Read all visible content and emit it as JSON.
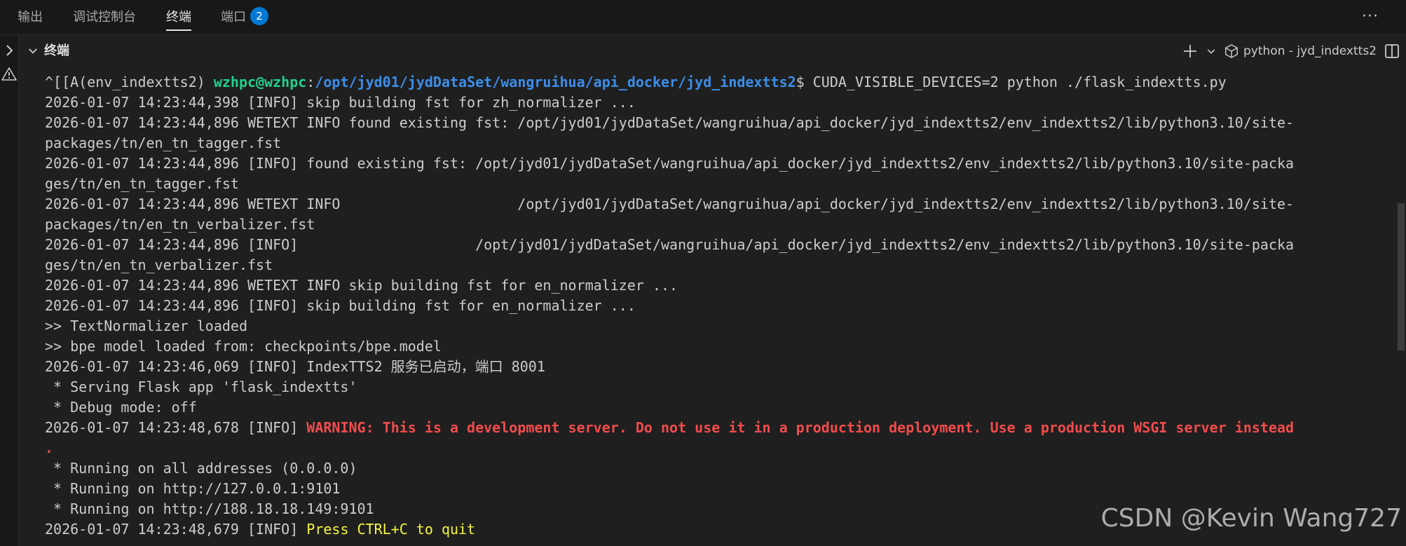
{
  "panel_tabs": [
    {
      "label": "输出"
    },
    {
      "label": "调试控制台"
    },
    {
      "label": "终端"
    },
    {
      "label": "端口",
      "badge": "2"
    }
  ],
  "active_tab": "终端",
  "terminal": {
    "title": "终端",
    "profile_label": "python - jyd_indextts2"
  },
  "prompt": {
    "prefix": "^[[A(env_indextts2) ",
    "user_host": "wzhpc@wzhpc",
    "colon": ":",
    "path": "/opt/jyd01/jydDataSet/wangruihua/api_docker/jyd_indextts2",
    "command": "$ CUDA_VISIBLE_DEVICES=2 python ./flask_indextts.py"
  },
  "lines": [
    "2026-01-07 14:23:44,398 [INFO] skip building fst for zh_normalizer ...",
    "2026-01-07 14:23:44,896 WETEXT INFO found existing fst: /opt/jyd01/jydDataSet/wangruihua/api_docker/jyd_indextts2/env_indextts2/lib/python3.10/site-",
    "packages/tn/en_tn_tagger.fst",
    "2026-01-07 14:23:44,896 [INFO] found existing fst: /opt/jyd01/jydDataSet/wangruihua/api_docker/jyd_indextts2/env_indextts2/lib/python3.10/site-packa",
    "ges/tn/en_tn_tagger.fst",
    "2026-01-07 14:23:44,896 WETEXT INFO                     /opt/jyd01/jydDataSet/wangruihua/api_docker/jyd_indextts2/env_indextts2/lib/python3.10/site-",
    "packages/tn/en_tn_verbalizer.fst",
    "2026-01-07 14:23:44,896 [INFO]                     /opt/jyd01/jydDataSet/wangruihua/api_docker/jyd_indextts2/env_indextts2/lib/python3.10/site-packa",
    "ges/tn/en_tn_verbalizer.fst",
    "2026-01-07 14:23:44,896 WETEXT INFO skip building fst for en_normalizer ...",
    "2026-01-07 14:23:44,896 [INFO] skip building fst for en_normalizer ...",
    ">> TextNormalizer loaded",
    ">> bpe model loaded from: checkpoints/bpe.model",
    "2026-01-07 14:23:46,069 [INFO] IndexTTS2 服务已启动，端口 8001",
    " * Serving Flask app 'flask_indextts'",
    " * Debug mode: off"
  ],
  "warning_line": {
    "prefix": "2026-01-07 14:23:48,678 [INFO] ",
    "message": "WARNING: This is a development server. Do not use it in a production deployment. Use a production WSGI server instead",
    "wrap": "."
  },
  "lines_after": [
    " * Running on all addresses (0.0.0.0)",
    " * Running on http://127.0.0.1:9101",
    " * Running on http://188.18.18.149:9101"
  ],
  "last_line": {
    "prefix": "2026-01-07 14:23:48,679 [INFO] ",
    "message": "Press CTRL+C to quit"
  },
  "watermark": "CSDN @Kevin Wang727",
  "colors": {
    "background": "#1f1f1f",
    "text": "#cccccc",
    "green": "#23d18b",
    "blue": "#3b8eea",
    "red": "#f14c4c",
    "yellow": "#f5f543",
    "badge": "#0078d4"
  }
}
